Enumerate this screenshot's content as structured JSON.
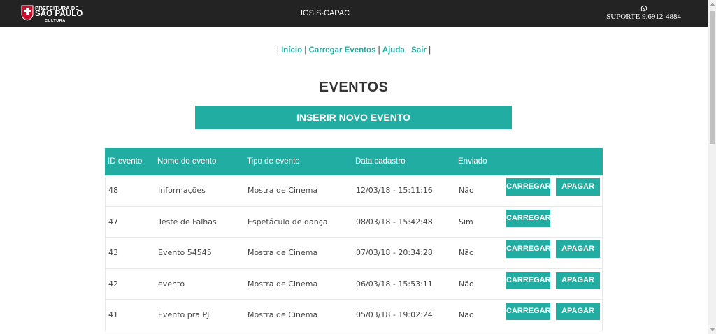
{
  "header": {
    "logo": {
      "line1": "PREFEITURA DE",
      "line2": "SÃO PAULO",
      "line3": "CULTURA"
    },
    "brand": "IGSIS-CAPAC",
    "support": "SUPORTE 9.6912-4884",
    "support_icon": "whatsapp-icon"
  },
  "menu": {
    "sep_open": "|",
    "items": [
      "Início",
      "Carregar Eventos",
      "Ajuda",
      "Sair"
    ],
    "sep": "|"
  },
  "page_title": "EVENTOS",
  "insert_button": "INSERIR NOVO EVENTO",
  "table": {
    "headers": [
      "ID evento",
      "Nome do evento",
      "Tipo de evento",
      "Data cadastro",
      "Enviado"
    ],
    "rows": [
      {
        "id": "48",
        "nome": "Informações",
        "tipo": "Mostra de Cinema",
        "data": "12/03/18 - 15:11:16",
        "enviado": "Não",
        "carregar": "CARREGAR",
        "apagar": "APAGAR"
      },
      {
        "id": "47",
        "nome": "Teste de Falhas",
        "tipo": "Espetáculo de dança",
        "data": "08/03/18 - 15:42:48",
        "enviado": "Sim",
        "carregar": "CARREGAR",
        "apagar": ""
      },
      {
        "id": "43",
        "nome": "Evento 54545",
        "tipo": "Mostra de Cinema",
        "data": "07/03/18 - 20:34:28",
        "enviado": "Não",
        "carregar": "CARREGAR",
        "apagar": "APAGAR"
      },
      {
        "id": "42",
        "nome": "evento",
        "tipo": "Mostra de Cinema",
        "data": "06/03/18 - 15:53:11",
        "enviado": "Não",
        "carregar": "CARREGAR",
        "apagar": "APAGAR"
      },
      {
        "id": "41",
        "nome": "Evento pra PJ",
        "tipo": "Mostra de Cinema",
        "data": "05/03/18 - 19:02:24",
        "enviado": "Não",
        "carregar": "CARREGAR",
        "apagar": "APAGAR"
      }
    ]
  },
  "colors": {
    "accent": "#21ada2",
    "navbar": "#232323"
  }
}
